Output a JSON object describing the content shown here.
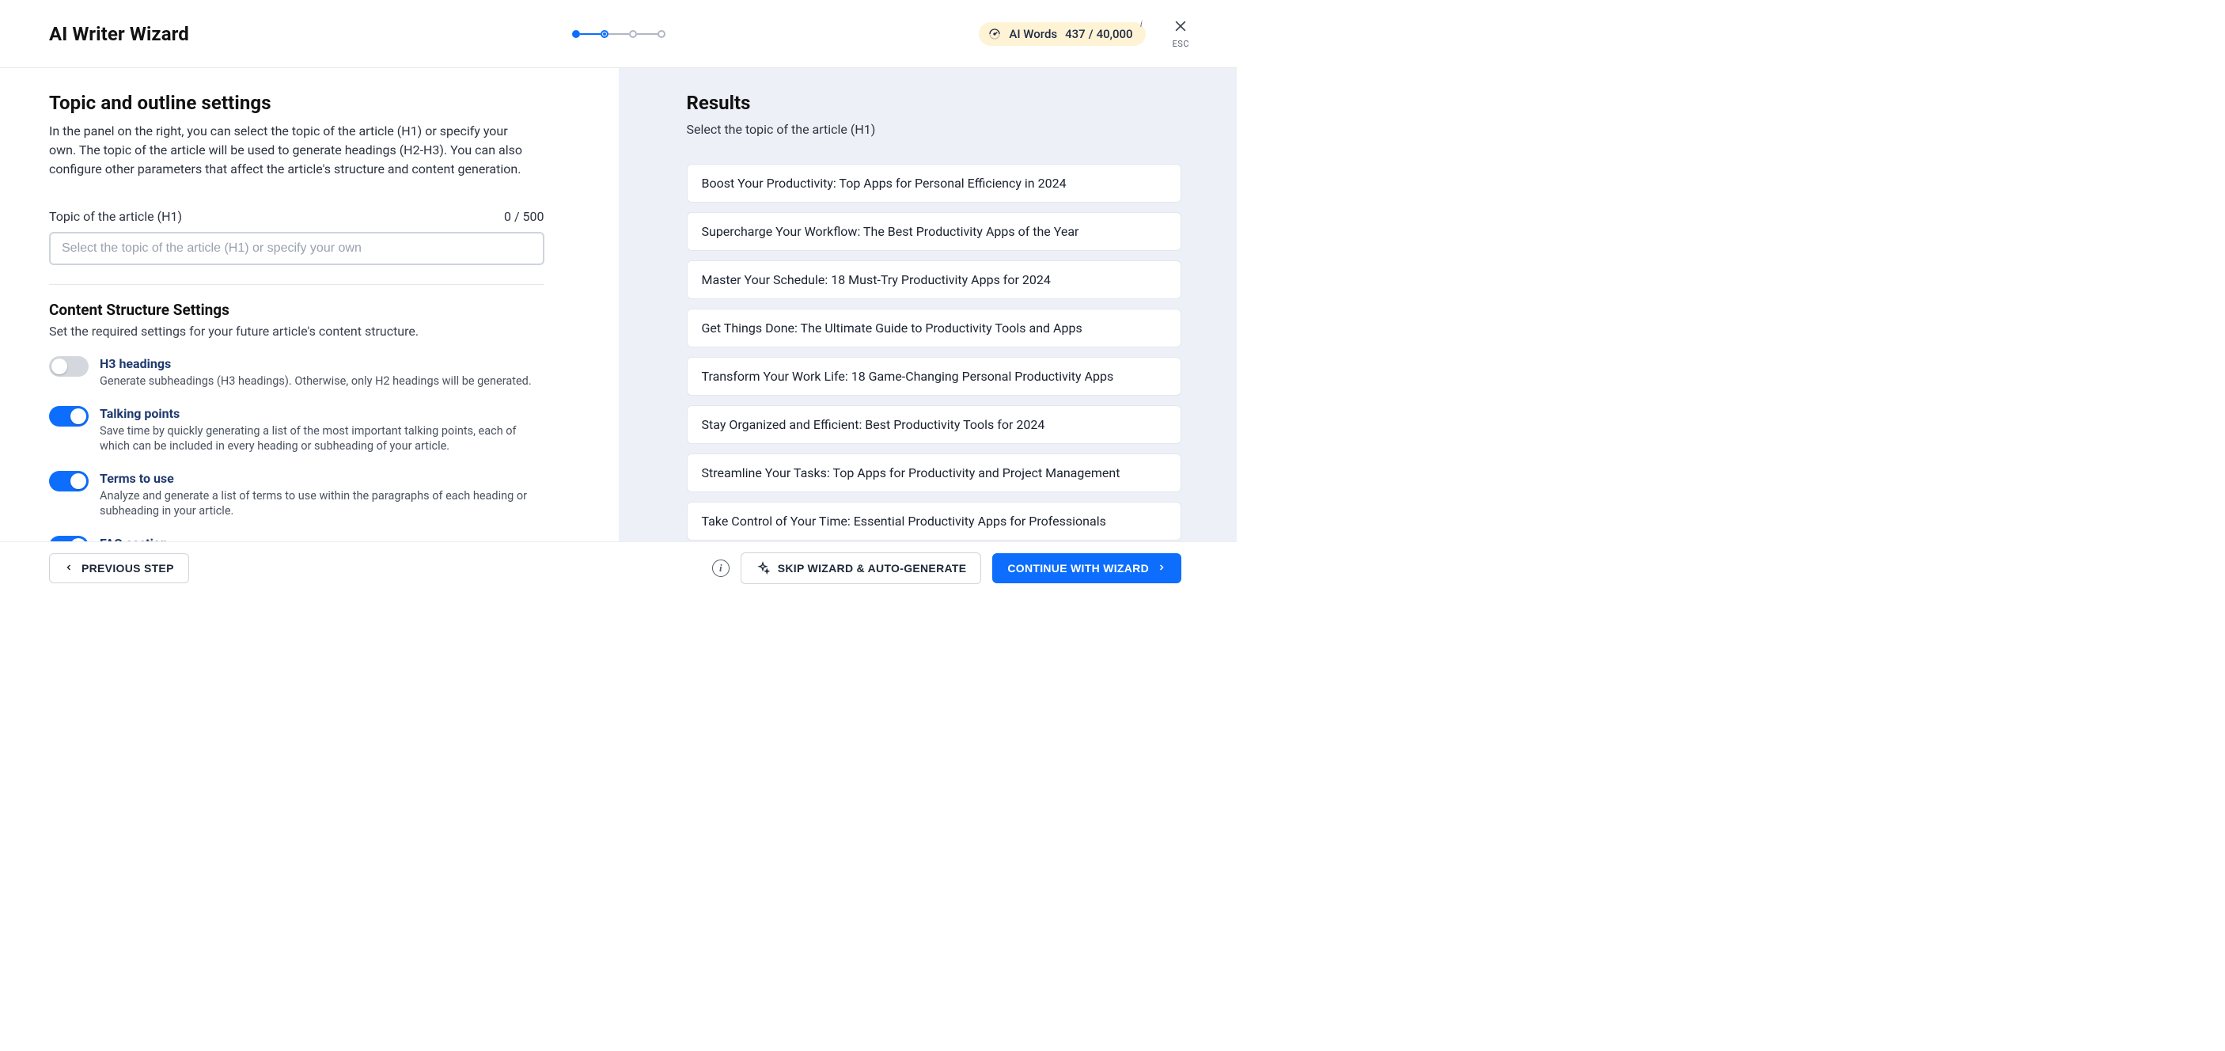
{
  "header": {
    "title": "AI Writer Wizard",
    "esc_label": "ESC",
    "ai_words": {
      "label": "AI Words",
      "used": "437",
      "sep": "/",
      "total": "40,000"
    },
    "stepper": {
      "total": 4,
      "current": 2
    }
  },
  "left": {
    "title": "Topic and outline settings",
    "description": "In the panel on the right, you can select the topic of the article (H1) or specify your own. The topic of the article will be used to generate headings (H2-H3). You can also configure other parameters that affect the article's structure and content generation.",
    "topic_label": "Topic of the article (H1)",
    "topic_counter": "0 / 500",
    "topic_placeholder": "Select the topic of the article (H1) or specify your own",
    "structure_title": "Content Structure Settings",
    "structure_desc": "Set the required settings for your future article's content structure.",
    "toggles": [
      {
        "key": "h3",
        "on": false,
        "title": "H3 headings",
        "desc": "Generate subheadings (H3 headings). Otherwise, only H2 headings will be generated."
      },
      {
        "key": "talking",
        "on": true,
        "title": "Talking points",
        "desc": "Save time by quickly generating a list of the most important talking points, each of which can be included in every heading or subheading of your article."
      },
      {
        "key": "terms",
        "on": true,
        "title": "Terms to use",
        "desc": "Analyze and generate a list of terms to use within the paragraphs of each heading or subheading in your article."
      },
      {
        "key": "faq",
        "on": true,
        "title": "FAQ section",
        "desc": ""
      }
    ]
  },
  "right": {
    "title": "Results",
    "subtitle": "Select the topic of the article (H1)",
    "items": [
      "Boost Your Productivity: Top Apps for Personal Efficiency in 2024",
      "Supercharge Your Workflow: The Best Productivity Apps of the Year",
      "Master Your Schedule: 18 Must-Try Productivity Apps for 2024",
      "Get Things Done: The Ultimate Guide to Productivity Tools and Apps",
      "Transform Your Work Life: 18 Game-Changing Personal Productivity Apps",
      "Stay Organized and Efficient: Best Productivity Tools for 2024",
      "Streamline Your Tasks: Top Apps for Productivity and Project Management",
      "Take Control of Your Time: Essential Productivity Apps for Professionals"
    ]
  },
  "footer": {
    "prev": "PREVIOUS STEP",
    "skip": "SKIP WIZARD & AUTO-GENERATE",
    "cont": "CONTINUE WITH WIZARD"
  }
}
